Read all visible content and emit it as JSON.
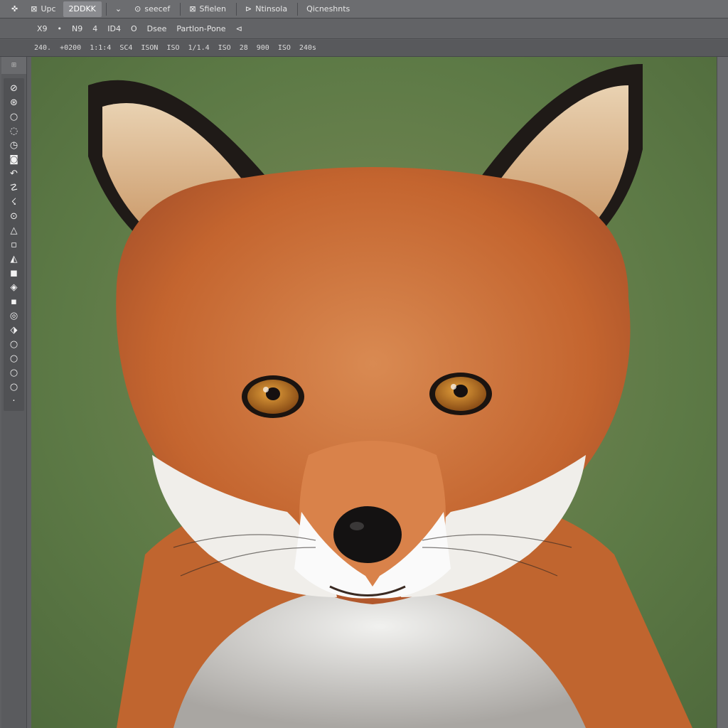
{
  "menubar": {
    "items": [
      {
        "icon": "✜",
        "label": ""
      },
      {
        "icon": "⊠",
        "label": "Upc"
      },
      {
        "icon": "",
        "label": "2DDKK"
      },
      {
        "icon": "⌄",
        "label": ""
      },
      {
        "icon": "⊙",
        "label": "seecef"
      },
      {
        "icon": "⊠",
        "label": "Sfielen"
      },
      {
        "icon": "⊳",
        "label": "Ntinsola"
      },
      {
        "icon": "",
        "label": "Qicneshnts"
      }
    ]
  },
  "optionsbar": {
    "items": [
      {
        "label": "X9"
      },
      {
        "label": "•"
      },
      {
        "label": "N9"
      },
      {
        "label": "4"
      },
      {
        "label": "ID4"
      },
      {
        "label": "O"
      },
      {
        "label": "Dsee"
      },
      {
        "label": "Partlon-Pone"
      },
      {
        "label": "⊲"
      }
    ]
  },
  "infobar": {
    "items": [
      "240.",
      "+0200",
      "1:1:4",
      "SC4",
      "ISON",
      "ISO",
      "1/1.4",
      "ISO",
      "28",
      "900",
      "ISO",
      "240s"
    ]
  },
  "toolbox": {
    "tools": [
      "⊘",
      "⊛",
      "○",
      "◌",
      "◷",
      "◙",
      "↶",
      "☡",
      "☇",
      "⊙",
      "△",
      "▫",
      "◭",
      "◼",
      "◈",
      "▪",
      "◎",
      "⬗",
      "○",
      "○",
      "○",
      "○",
      "·"
    ]
  },
  "canvas": {
    "subject": "fox",
    "bg_color": "#5f7d49",
    "fur_color": "#c8693a",
    "eye_color": "#b8701f"
  }
}
